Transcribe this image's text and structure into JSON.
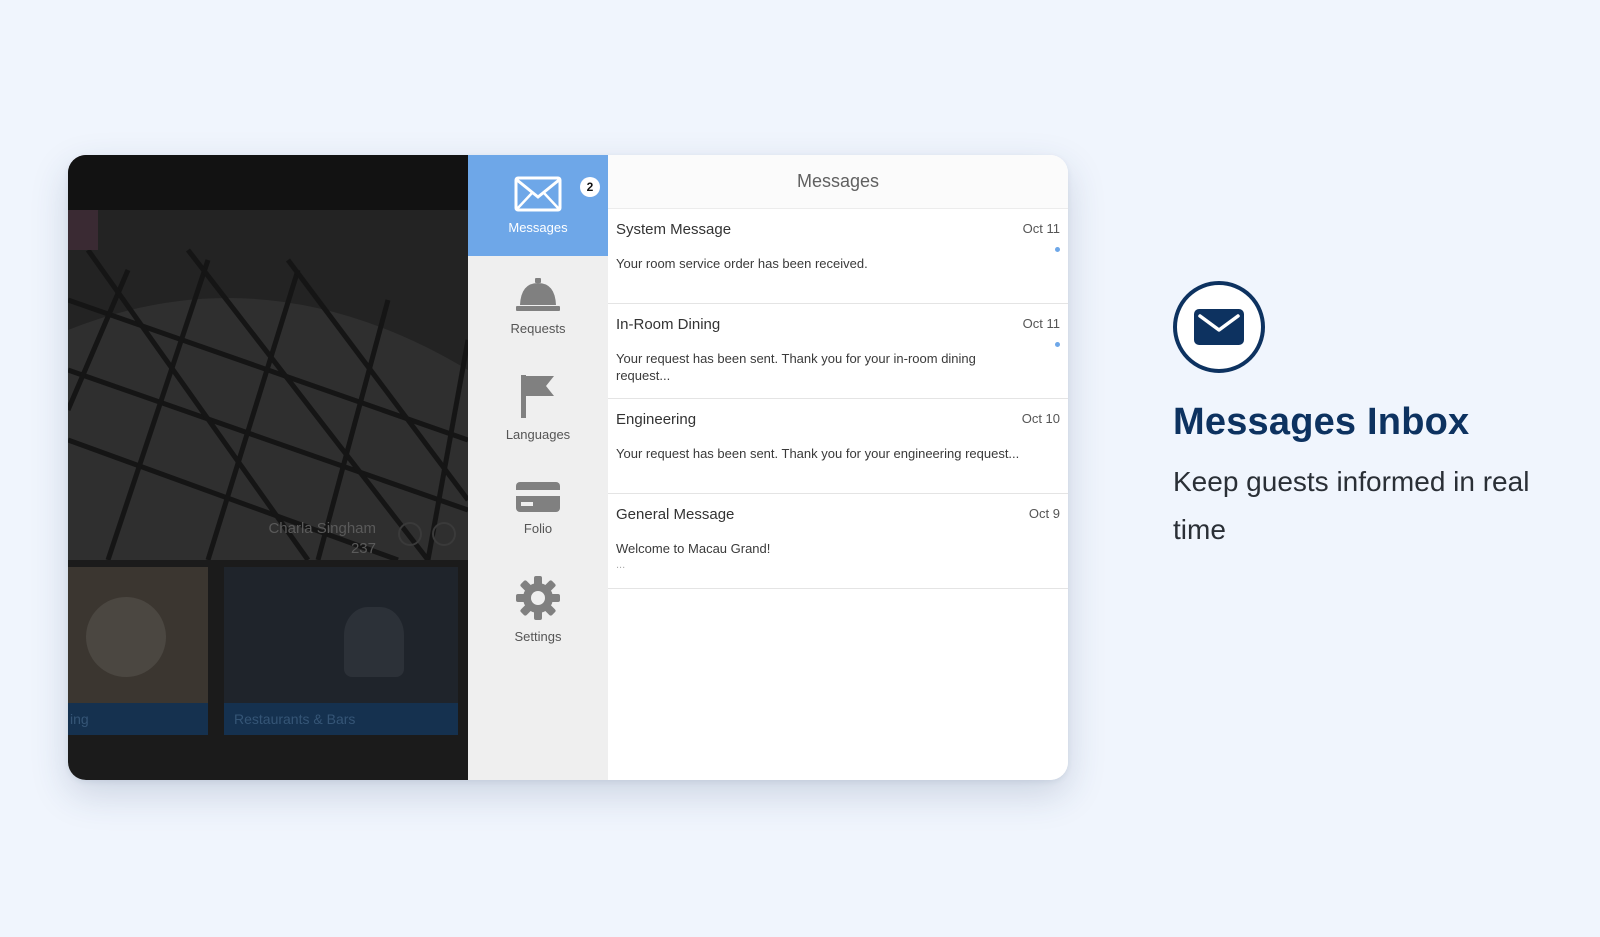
{
  "background_app": {
    "guest_name": "Charla Singham",
    "room_number": "237",
    "tiles": [
      {
        "caption": "ing"
      },
      {
        "caption": "Restaurants & Bars"
      }
    ]
  },
  "sidenav": {
    "items": [
      {
        "label": "Messages",
        "icon": "envelope-icon",
        "badge": "2",
        "active": true
      },
      {
        "label": "Requests",
        "icon": "service-bell-icon"
      },
      {
        "label": "Languages",
        "icon": "flag-icon"
      },
      {
        "label": "Folio",
        "icon": "credit-card-icon"
      },
      {
        "label": "Settings",
        "icon": "gear-icon"
      }
    ]
  },
  "panel": {
    "title": "Messages",
    "messages": [
      {
        "title": "System Message",
        "date": "Oct 11",
        "body": "Your room service order has been received.",
        "unread": true
      },
      {
        "title": "In-Room Dining",
        "date": "Oct 11",
        "body": "Your request has been sent. Thank you for your in-room dining request...",
        "unread": true
      },
      {
        "title": "Engineering",
        "date": "Oct 10",
        "body": "Your request has been sent. Thank you for your engineering request..."
      },
      {
        "title": "General Message",
        "date": "Oct 9",
        "body": "Welcome to Macau Grand!",
        "ellipsis": "..."
      }
    ]
  },
  "feature": {
    "icon": "envelope-icon",
    "title": "Messages Inbox",
    "description": "Keep guests informed in real time"
  },
  "colors": {
    "page_bg": "#f0f5fd",
    "nav_active": "#6ea7e8",
    "brand_navy": "#0d3260"
  }
}
